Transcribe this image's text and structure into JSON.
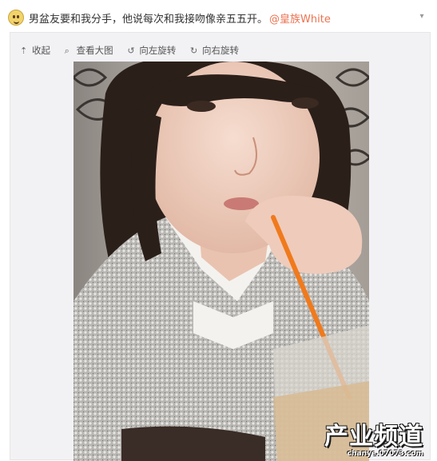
{
  "post": {
    "text": "男盆友要和我分手，他说每次和我接吻像亲五五开。",
    "mention": "@皇族White",
    "avatar_icon": "emoji-face-icon",
    "menu_icon": "chevron-down-icon"
  },
  "toolbar": {
    "items": [
      {
        "label": "收起",
        "icon": "collapse-arrow-icon",
        "glyph": "⇡"
      },
      {
        "label": "查看大图",
        "icon": "magnifier-icon",
        "glyph": "⌕"
      },
      {
        "label": "向左旋转",
        "icon": "rotate-left-icon",
        "glyph": "↺"
      },
      {
        "label": "向右旋转",
        "icon": "rotate-right-icon",
        "glyph": "↻"
      }
    ]
  },
  "watermark": {
    "main": "产业频道",
    "sub": "chanye.07073.com"
  },
  "colors": {
    "mention": "#eb7350",
    "card_bg": "#f2f2f5",
    "straw": "#f07a1c"
  }
}
